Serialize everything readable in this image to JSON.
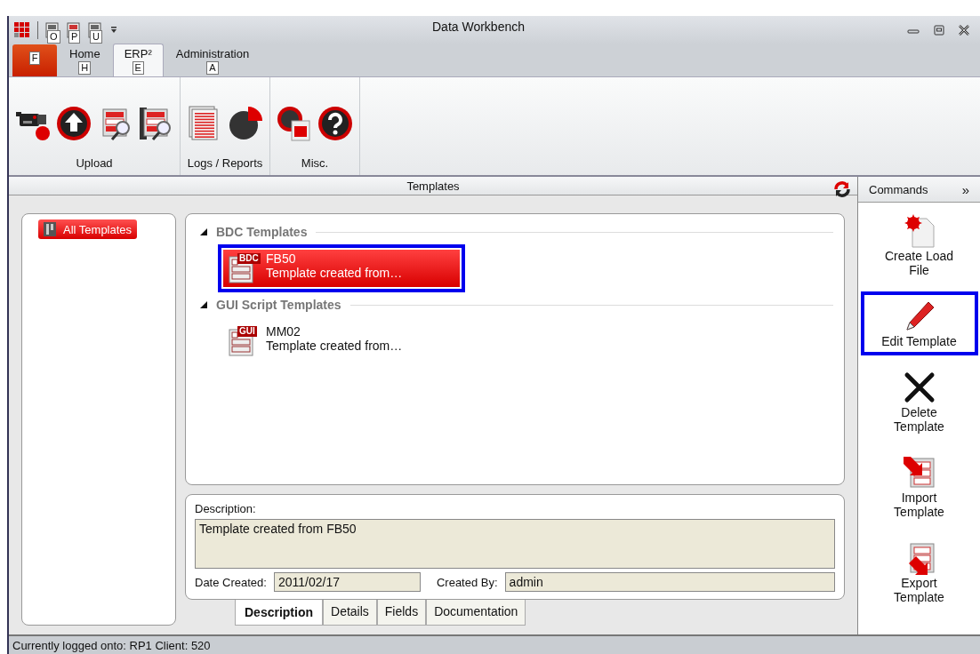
{
  "window": {
    "title": "Data Workbench"
  },
  "quick_access": [
    {
      "keytip": "O"
    },
    {
      "keytip": "P"
    },
    {
      "keytip": "U"
    }
  ],
  "ribbon_tabs": [
    {
      "kind": "file",
      "keytip": "F",
      "selected": false
    },
    {
      "kind": "tab",
      "label": "Home",
      "keytip": "H",
      "selected": false
    },
    {
      "kind": "tab",
      "label": "ERP²",
      "keytip": "E",
      "selected": true
    },
    {
      "kind": "tab",
      "label": "Administration",
      "keytip": "A",
      "selected": false
    }
  ],
  "ribbon_groups": [
    {
      "label": "Upload"
    },
    {
      "label": "Logs / Reports"
    },
    {
      "label": "Misc."
    }
  ],
  "templates_panel": {
    "title": "Templates"
  },
  "categories": [
    {
      "label": "All Templates",
      "selected": true
    }
  ],
  "template_groups": [
    {
      "name": "BDC Templates",
      "expanded": true,
      "items": [
        {
          "badge": "BDC",
          "name": "FB50",
          "description": "Template created from…",
          "selected": true,
          "highlighted": true
        }
      ]
    },
    {
      "name": "GUI Script Templates",
      "expanded": true,
      "items": [
        {
          "badge": "GUI",
          "name": "MM02",
          "description": "Template created from…",
          "selected": false,
          "highlighted": false
        }
      ]
    }
  ],
  "details": {
    "description_label": "Description:",
    "description": "Template created from FB50",
    "date_label": "Date Created:",
    "date": "2011/02/17",
    "created_by_label": "Created By:",
    "created_by": "admin"
  },
  "detail_tabs": [
    {
      "label": "Description",
      "selected": true
    },
    {
      "label": "Details",
      "selected": false
    },
    {
      "label": "Fields",
      "selected": false
    },
    {
      "label": "Documentation",
      "selected": false
    }
  ],
  "commands": {
    "title": "Commands",
    "toggle": "»",
    "items": [
      {
        "kind": "create",
        "label": "Create Load\nFile",
        "highlighted": false
      },
      {
        "kind": "edit",
        "label": "Edit Template",
        "highlighted": true
      },
      {
        "kind": "delete",
        "label": "Delete\nTemplate",
        "highlighted": false
      },
      {
        "kind": "import",
        "label": "Import\nTemplate",
        "highlighted": false
      },
      {
        "kind": "export",
        "label": "Export\nTemplate",
        "highlighted": false
      }
    ]
  },
  "status_bar": "Currently logged onto: RP1 Client: 520"
}
